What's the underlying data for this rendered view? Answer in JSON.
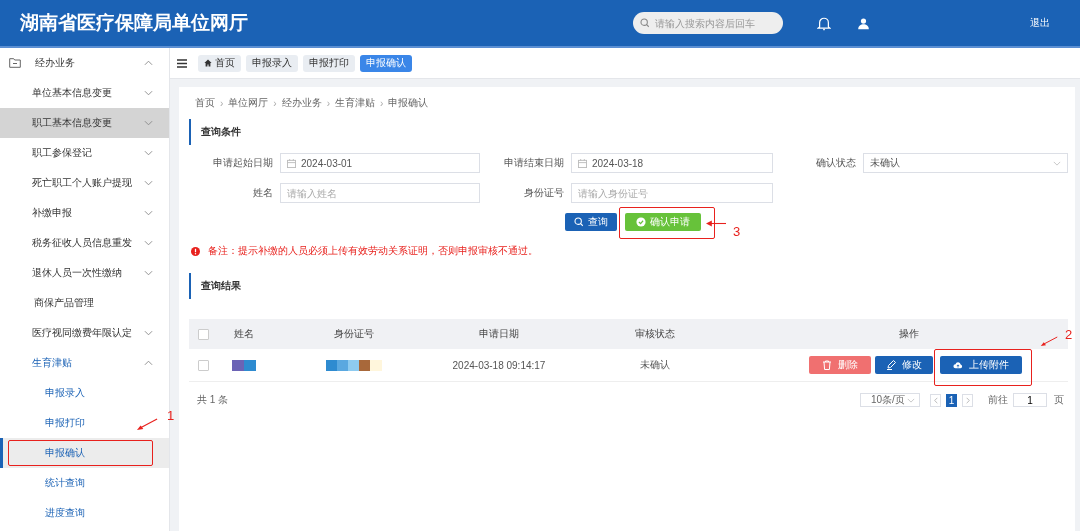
{
  "header": {
    "title": "湖南省医疗保障局单位网厅",
    "search": {
      "placeholder": "请输入搜索内容后回车"
    },
    "logout": "退出"
  },
  "sidebar": {
    "group": {
      "label": "经办业务",
      "expanded": true,
      "children": [
        {
          "label": "单位基本信息变更",
          "kind": "expandable",
          "expanded": false,
          "hovered": false
        },
        {
          "label": "职工基本信息变更",
          "kind": "expandable",
          "expanded": false,
          "hovered": true
        },
        {
          "label": "职工参保登记",
          "kind": "expandable",
          "expanded": false,
          "hovered": false
        },
        {
          "label": "死亡职工个人账户提现",
          "kind": "expandable",
          "expanded": false,
          "hovered": false
        },
        {
          "label": "补缴申报",
          "kind": "expandable",
          "expanded": false,
          "hovered": false
        },
        {
          "label": "税务征收人员信息重发",
          "kind": "expandable",
          "expanded": false,
          "hovered": false
        },
        {
          "label": "退休人员一次性缴纳",
          "kind": "expandable",
          "expanded": false,
          "hovered": false
        },
        {
          "label": "商保产品管理",
          "kind": "link",
          "hovered": false
        },
        {
          "label": "医疗视同缴费年限认定",
          "kind": "expandable",
          "expanded": false,
          "hovered": false
        },
        {
          "label": "生育津贴",
          "kind": "expandable",
          "expanded": true,
          "hovered": false,
          "children": [
            {
              "label": "申报录入",
              "selected": false
            },
            {
              "label": "申报打印",
              "selected": false
            },
            {
              "label": "申报确认",
              "selected": true,
              "callout": "1"
            },
            {
              "label": "统计查询",
              "selected": false
            },
            {
              "label": "进度查询",
              "selected": false
            }
          ]
        }
      ]
    }
  },
  "tags": [
    {
      "label": "首页",
      "kind": "home",
      "selected": false
    },
    {
      "label": "申报录入",
      "kind": "plain",
      "selected": false
    },
    {
      "label": "申报打印",
      "kind": "plain",
      "selected": false
    },
    {
      "label": "申报确认",
      "kind": "plain",
      "selected": true
    }
  ],
  "breadcrumb": [
    {
      "label": "首页"
    },
    {
      "separator": "›",
      "label": "单位网厅"
    },
    {
      "separator": "›",
      "label": "经办业务"
    },
    {
      "separator": "›",
      "label": "生育津贴"
    },
    {
      "separator": "›",
      "label": "申报确认"
    }
  ],
  "query": {
    "title": "查询条件",
    "fields": [
      {
        "label": "申请起始日期",
        "kind": "date",
        "value": "2024-03-01"
      },
      {
        "label": "申请结束日期",
        "kind": "date",
        "value": "2024-03-18"
      },
      {
        "label": "确认状态",
        "kind": "select",
        "value": "未确认"
      },
      {
        "label": "姓名",
        "kind": "text",
        "placeholder": "请输入姓名"
      },
      {
        "label": "身份证号",
        "kind": "text",
        "placeholder": "请输入身份证号"
      }
    ],
    "buttons": [
      {
        "label": "查询",
        "kind": "search"
      },
      {
        "label": "确认申请",
        "kind": "confirm",
        "callout": "3"
      }
    ],
    "note": "备注：提示补缴的人员必须上传有效劳动关系证明，否则申报审核不通过。"
  },
  "results": {
    "title": "查询结果",
    "table": {
      "select_all_checked": false,
      "columns": [
        "姓名",
        "身份证号",
        "申请日期",
        "审核状态",
        "操作"
      ],
      "rows": [
        {
          "checked": false,
          "cells": [
            {
              "kind": "redacted"
            },
            {
              "kind": "redacted"
            },
            {
              "kind": "text",
              "text": "2024-03-18 09:14:17"
            },
            {
              "kind": "text",
              "text": "未确认"
            }
          ],
          "actions": [
            {
              "label": "删除",
              "kind": "delete"
            },
            {
              "label": "修改",
              "kind": "edit"
            },
            {
              "label": "上传附件",
              "kind": "upload",
              "callout": "2"
            }
          ]
        }
      ]
    },
    "total": "共 1 条",
    "pagination": {
      "page_size": "10条/页",
      "pages": [
        {
          "label": "1",
          "selected": true
        }
      ],
      "goto_label": "前往",
      "goto_value": "1",
      "goto_suffix": "页"
    }
  }
}
